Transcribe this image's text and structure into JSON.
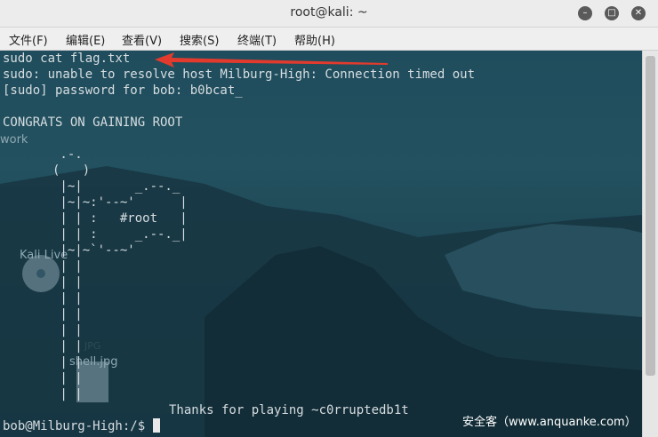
{
  "window": {
    "title": "root@kali: ~"
  },
  "menu": [
    {
      "label": "文件(F)"
    },
    {
      "label": "编辑(E)"
    },
    {
      "label": "查看(V)"
    },
    {
      "label": "搜索(S)"
    },
    {
      "label": "终端(T)"
    },
    {
      "label": "帮助(H)"
    }
  ],
  "terminal": {
    "lines": [
      "sudo cat flag.txt",
      "sudo: unable to resolve host Milburg-High: Connection timed out",
      "[sudo] password for bob: b0bcat_",
      "",
      "CONGRATS ON GAINING ROOT"
    ],
    "art": "        .-.\n       (   )\n        |~|       _.--._\n        |~|~:'--~'      |\n        | | :   #root   |\n        | | :     _.--._|\n        |~|~`'--~'\n        | |\n        | |\n        | |\n        | |\n        | |\n        | |\n        | |\n        | |\n        | |",
    "thanks": "Thanks for playing ~c0rruptedb1t",
    "prompt": "bob@Milburg-High:/$ "
  },
  "desktop": {
    "labels": [
      "work",
      "Kali Live",
      "shell.jpg",
      "JPG"
    ]
  },
  "watermark": "安全客（www.anquanke.com）",
  "colors": {
    "accent_arrow": "#e23b2e",
    "terminal_text": "#d7dde0"
  }
}
